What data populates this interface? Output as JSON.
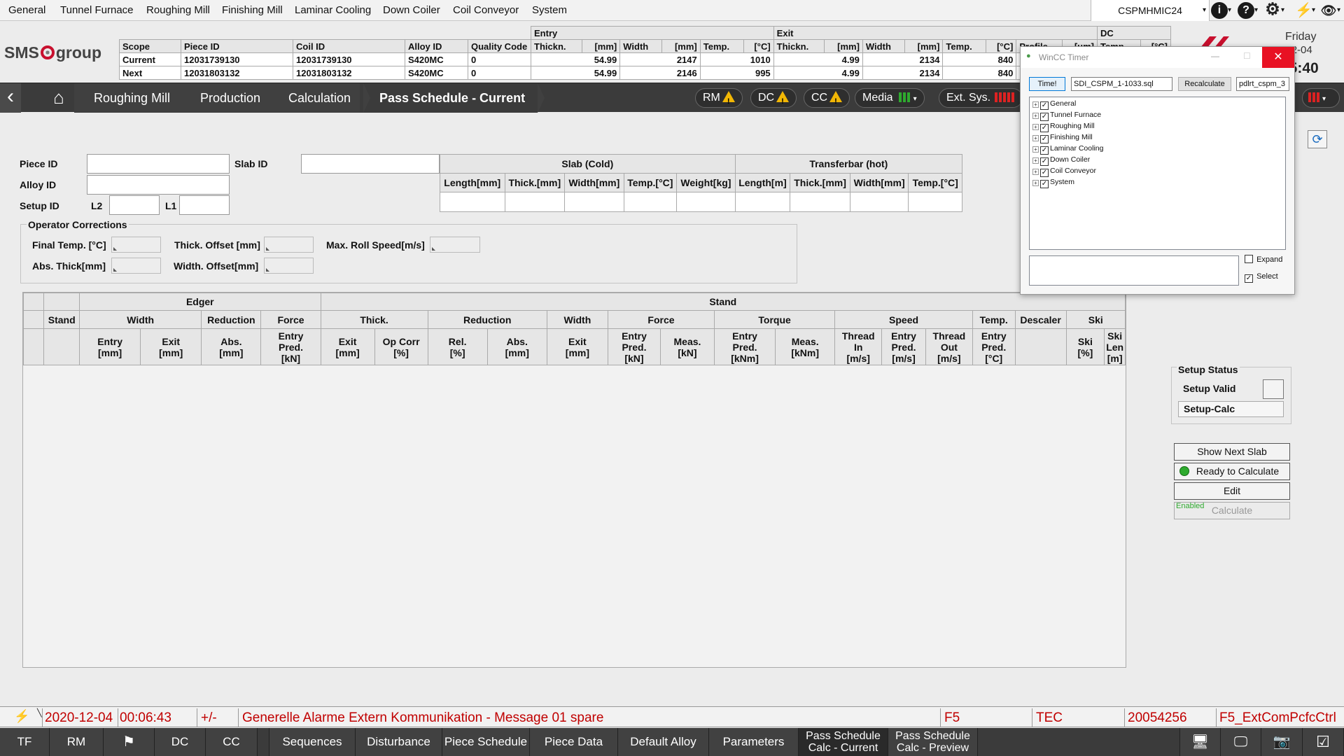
{
  "menu": {
    "items": [
      "General",
      "Tunnel Furnace",
      "Roughing Mill",
      "Finishing Mill",
      "Laminar Cooling",
      "Down Coiler",
      "Coil Conveyor",
      "System"
    ],
    "host": "CSPMHMIC24"
  },
  "header": {
    "logo": {
      "pre": "SMS",
      "post": "group"
    },
    "group_entry": "Entry",
    "group_exit": "Exit",
    "group_dc": "DC",
    "columns": [
      "Scope",
      "Piece ID",
      "Coil ID",
      "Alloy ID",
      "Quality Code",
      "Thickn.",
      "[mm]",
      "Width",
      "[mm]",
      "Temp.",
      "[°C]",
      "Thickn.",
      "[mm]",
      "Width",
      "[mm]",
      "Temp.",
      "[°C]",
      "Profile",
      "[um]",
      "Temp.",
      "[°C]"
    ],
    "rows": [
      {
        "scope": "Current",
        "piece_id": "12031739130",
        "coil_id": "12031739130",
        "alloy": "S420MC",
        "quality": "0",
        "en_thick": "54.99",
        "en_width": "2147",
        "en_temp": "1010",
        "ex_thick": "4.99",
        "ex_width": "2134",
        "ex_temp": "840"
      },
      {
        "scope": "Next",
        "piece_id": "12031803132",
        "coil_id": "12031803132",
        "alloy": "S420MC",
        "quality": "0",
        "en_thick": "54.99",
        "en_width": "2146",
        "en_temp": "995",
        "ex_thick": "4.99",
        "ex_width": "2134",
        "ex_temp": "840"
      }
    ],
    "day": "Friday",
    "date": "2020-12-04",
    "time": "05:40"
  },
  "nav": {
    "breadcrumbs": [
      "Roughing Mill",
      "Production",
      "Calculation",
      "Pass Schedule - Current"
    ],
    "pills": {
      "rm": "RM",
      "dc": "DC",
      "cc": "CC",
      "media": "Media",
      "ext": "Ext. Sys."
    }
  },
  "form": {
    "piece_id": "Piece ID",
    "slab_id": "Slab ID",
    "alloy_id": "Alloy ID",
    "setup_id": "Setup ID",
    "l2": "L2",
    "l1": "L1",
    "slab_cold": "Slab (Cold)",
    "transferbar": "Transferbar (hot)",
    "slab_cols": [
      "Length[mm]",
      "Thick.[mm]",
      "Width[mm]",
      "Temp.[°C]",
      "Weight[kg]"
    ],
    "tb_cols": [
      "Length[m]",
      "Thick.[mm]",
      "Width[mm]",
      "Temp.[°C]"
    ],
    "opcorr_title": "Operator Corrections",
    "final_temp": "Final Temp. [°C]",
    "abs_thick": "Abs. Thick[mm]",
    "thick_offset": "Thick. Offset [mm]",
    "width_offset": "Width. Offset[mm]",
    "max_roll": "Max. Roll Speed[m/s]"
  },
  "table": {
    "edger": "Edger",
    "stand_group": "Stand",
    "stand": "Stand",
    "g2": [
      "Width",
      "Reduction",
      "Force",
      "Thick.",
      "Reduction",
      "Width",
      "Force",
      "Torque",
      "Speed",
      "Temp.",
      "Descaler",
      "Ski"
    ],
    "sub": [
      [
        "Entry",
        "[mm]"
      ],
      [
        "Exit",
        "[mm]"
      ],
      [
        "Abs.",
        "[mm]"
      ],
      [
        "Entry",
        "Pred.",
        "[kN]"
      ],
      [
        "Exit",
        "[mm]"
      ],
      [
        "Op Corr",
        "[%]"
      ],
      [
        "Rel.",
        "[%]"
      ],
      [
        "Abs.",
        "[mm]"
      ],
      [
        "Exit",
        "[mm]"
      ],
      [
        "Entry",
        "Pred.",
        "[kN]"
      ],
      [
        "Meas.",
        "[kN]"
      ],
      [
        "Entry",
        "Pred.",
        "[kNm]"
      ],
      [
        "Meas.",
        "[kNm]"
      ],
      [
        "Thread",
        "In",
        "[m/s]"
      ],
      [
        "Entry",
        "Pred.",
        "[m/s]"
      ],
      [
        "Thread",
        "Out",
        "[m/s]"
      ],
      [
        "Entry",
        "Pred.",
        "[°C]"
      ],
      [
        ""
      ],
      [
        "Ski",
        "[%]"
      ],
      [
        "Ski",
        "Len",
        "[m]"
      ]
    ]
  },
  "right": {
    "setup_status": "Setup Status",
    "setup_valid": "Setup Valid",
    "setup_calc": "Setup-Calc",
    "show_next": "Show Next Slab",
    "ready": "Ready to Calculate",
    "edit": "Edit",
    "enabled": "Enabled",
    "calculate": "Calculate"
  },
  "alarm": {
    "date": "2020-12-04",
    "time": "00:06:43",
    "sign": "+/-",
    "message": "Generelle Alarme Extern Kommunikation - Message 01 spare",
    "key": "F5",
    "area": "TEC",
    "number": "20054256",
    "tag": "F5_ExtComPcfcCtrl"
  },
  "bottom": {
    "tf": "TF",
    "rm": "RM",
    "dc": "DC",
    "cc": "CC",
    "tabs": [
      "Sequences",
      "Disturbance",
      "Piece Schedule",
      "Piece Data",
      "Default Alloy",
      "Parameters"
    ],
    "pass_cur": [
      "Pass Schedule",
      "Calc - Current"
    ],
    "pass_prev": [
      "Pass Schedule",
      "Calc - Preview"
    ]
  },
  "wincc": {
    "title": "WinCC Timer",
    "time_btn": "Time!",
    "file": "SDI_CSPM_1-1033.sql",
    "recalc": "Recalculate",
    "db": "pdlrt_cspm_3",
    "tree": [
      "General",
      "Tunnel Furnace",
      "Roughing Mill",
      "Finishing Mill",
      "Laminar Cooling",
      "Down Coiler",
      "Coil Conveyor",
      "System"
    ],
    "expand": "Expand",
    "select": "Select"
  },
  "colors": {
    "accent_green": "#2eaa2e",
    "alarm_red": "#c00000",
    "warn_yellow": "#f2b705",
    "nav_bg": "#3b3b3b"
  }
}
